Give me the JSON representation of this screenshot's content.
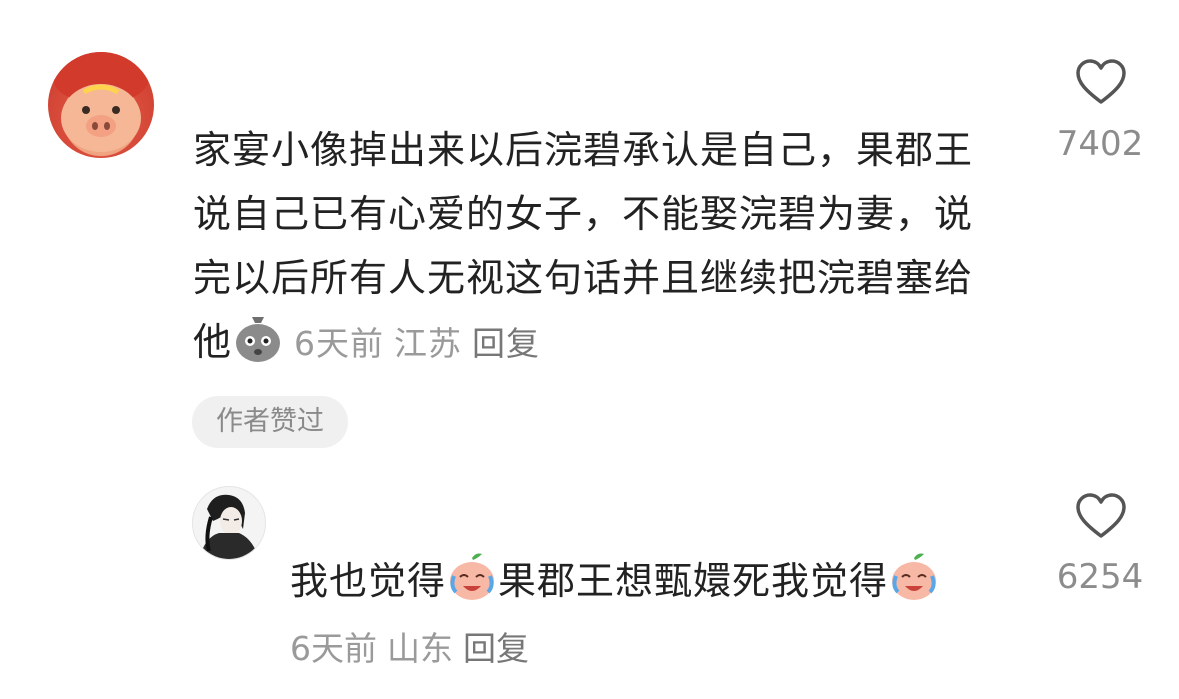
{
  "comment": {
    "text": "家宴小像掉出来以后浣碧承认是自己，果郡王说自己已有心爱的女子，不能娶浣碧为妻，说完以后所有人无视这句话并且继续把浣碧塞给他",
    "emoji_icon": "speechless-sack-emoji",
    "time": "6天前",
    "location": "江苏",
    "reply_label": "回复",
    "badge": "作者赞过",
    "likes": "7402"
  },
  "reply": {
    "text_part1": "我也觉得",
    "text_part2": "果郡王想甄嬛死我觉得",
    "emoji_icon": "crying-laughing-peach-emoji",
    "time": "6天前",
    "location": "山东",
    "reply_label": "回复",
    "likes": "6254"
  },
  "colors": {
    "text": "#222222",
    "meta": "#9a9a9a",
    "badge_bg": "#f0f0f0"
  }
}
